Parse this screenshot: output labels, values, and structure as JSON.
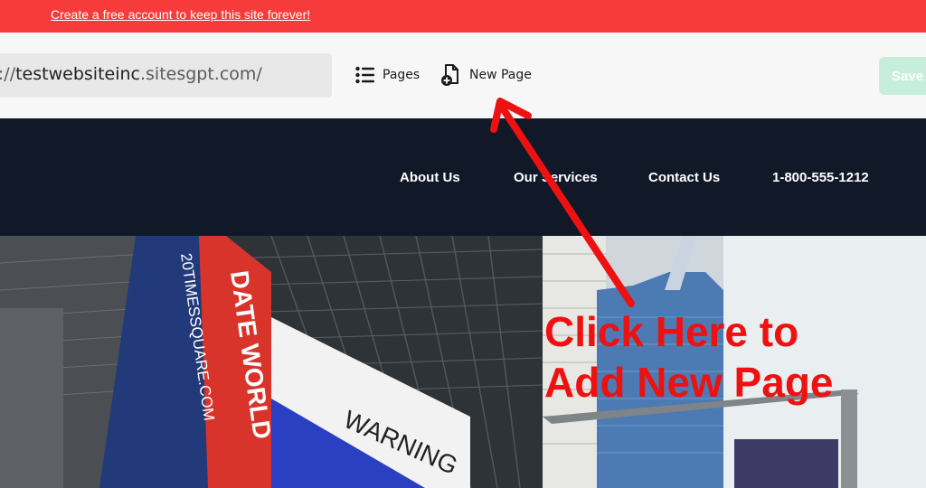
{
  "promo": {
    "link_text": "Create a free account to keep this site forever!"
  },
  "toolbar": {
    "url_prefix": "s://",
    "url_domain": "testwebsiteinc",
    "url_suffix": ".sitesgpt.com/",
    "pages_label": "Pages",
    "new_page_label": "New Page",
    "save_label": "Save"
  },
  "nav": {
    "items": [
      {
        "label": "About Us"
      },
      {
        "label": "Our Services"
      },
      {
        "label": "Contact Us"
      },
      {
        "label": "1-800-555-1212"
      }
    ]
  },
  "hero": {
    "sign_text": "20TIMESSQUARE.COM",
    "warning_text": "WARNING",
    "billboard_text": "DATE WORLD"
  },
  "annotation": {
    "line1": "Click Here to",
    "line2": "Add New Page",
    "color": "#ee1111"
  },
  "colors": {
    "promo_bg": "#f73b3b",
    "nav_bg": "#111827",
    "save_bg": "#c7eedc"
  }
}
